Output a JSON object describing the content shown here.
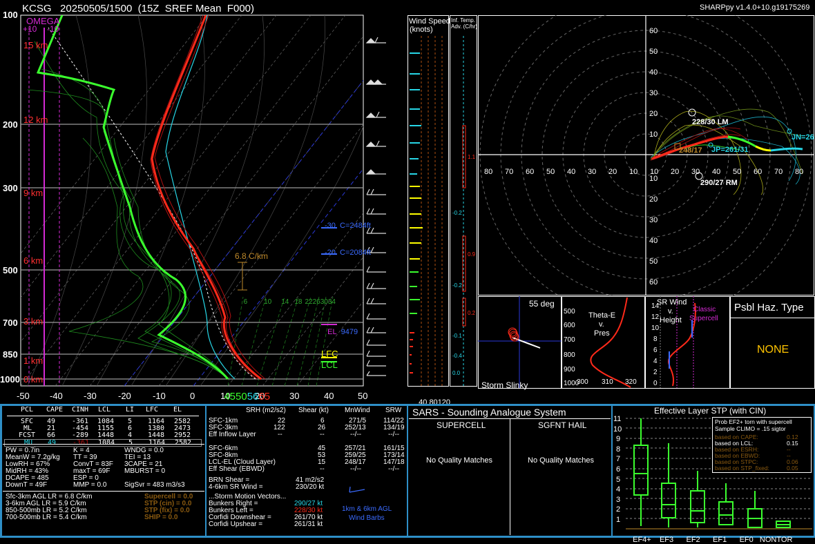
{
  "header": {
    "title": "KCSG   20250505/1500  (15Z  SREF Mean  F000)",
    "version": "SHARPpy v1.4.0+10.g19175269"
  },
  "skewt": {
    "pressure_labels": [
      "100",
      "200",
      "300",
      "500",
      "700",
      "850",
      "1000"
    ],
    "height_labels": [
      "15 km",
      "12 km",
      "9 km",
      "6 km",
      "3 km",
      "1 km",
      "0 km"
    ],
    "temp_labels": [
      "-50",
      "-40",
      "-30",
      "-20",
      "-10",
      "0",
      "10",
      "20",
      "30",
      "40",
      "50"
    ],
    "omega_title": "OMEGA",
    "omega_plus": "+10",
    "omega_minus": "-10",
    "lapse_rate_label": "6.8 C/km",
    "mix_ratio_labels": [
      "6",
      "10",
      "14",
      "18",
      "22",
      "26",
      "30",
      "34"
    ],
    "annotations": {
      "m30": "-30  C=2484ft",
      "m20": "-20  C=2084ft",
      "el": "EL",
      "el_val": "9479",
      "lfc": "LFC",
      "lcl": "LCL"
    },
    "sfc_td": "45",
    "sfc_tw": "50",
    "sfc_wb": "56",
    "sfc_t": "65"
  },
  "wind_speed_panel": {
    "title_line1": "Wind Speed",
    "title_line2": "(knots)",
    "ticks": [
      "40",
      "80",
      "120"
    ]
  },
  "inferred_temp_panel": {
    "title_line1": "Inf. Temp.",
    "title_line2": "Adv. (C/hr)",
    "values": [
      "1.1",
      "-0.2",
      "0.9",
      "-0.2",
      "0.2",
      "-0.1",
      "-0.4",
      "0.0"
    ]
  },
  "hodograph": {
    "rings_y": [
      "60",
      "50",
      "40",
      "30",
      "20",
      "10",
      "10",
      "20",
      "30",
      "40",
      "50",
      "60"
    ],
    "rings_x": [
      "80",
      "70",
      "60",
      "50",
      "40",
      "30",
      "20",
      "10",
      "10",
      "20",
      "30",
      "40",
      "50",
      "60",
      "70",
      "80"
    ],
    "rm_label": "228/30 LM",
    "lm_label": "290/27 RM",
    "mw_label": "248/17",
    "jp_label": "JP=261/31",
    "jn_label": "JN=26"
  },
  "storm_slinky": {
    "angle": "55 deg",
    "title": "Storm Slinky"
  },
  "theta_e": {
    "title_l1": "Theta-E",
    "title_l2": "v.",
    "title_l3": "Pres",
    "p_labels": [
      "500",
      "600",
      "700",
      "800",
      "900",
      "1000"
    ],
    "x_labels": [
      "300",
      "310",
      "320"
    ]
  },
  "sr_wind": {
    "title_l1": "SR Wind",
    "title_l2": "v.",
    "title_l3": "Height",
    "h_labels": [
      "14",
      "12",
      "10",
      "8",
      "6",
      "4",
      "2",
      "0"
    ],
    "classic_l1": "Classic",
    "classic_l2": "Supercell"
  },
  "hazard": {
    "title": "Psbl Haz. Type",
    "value": "NONE"
  },
  "parcels": {
    "headers": [
      "PCL",
      "CAPE",
      "CINH",
      "LCL",
      "LI",
      "LFC",
      "EL"
    ],
    "rows": [
      [
        "SFC",
        "49",
        "-361",
        "1084",
        "5",
        "1164",
        "2582"
      ],
      [
        "ML",
        "21",
        "-454",
        "1155",
        "6",
        "1380",
        "2473"
      ],
      [
        "FCST",
        "66",
        "-289",
        "1448",
        "4",
        "1448",
        "2952"
      ],
      [
        "MU",
        "49",
        "-361",
        "1084",
        "5",
        "1164",
        "2582"
      ]
    ]
  },
  "indices": {
    "col1": [
      "PW = 0.7in",
      "MeanW = 7.2g/kg",
      "LowRH = 67%",
      "MidRH = 43%",
      "DCAPE = 485",
      "DownT = 49F"
    ],
    "col2": [
      "K = 4",
      "TT = 39",
      "ConvT = 83F",
      "maxT = 69F",
      "ESP = 0",
      "MMP = 0.0"
    ],
    "col3": [
      "WNDG = 0.0",
      "TEI = 13",
      "3CAPE = 21",
      "MBURST = 0",
      "",
      "SigSvr = 483 m3/s3"
    ],
    "lapse": [
      "Sfc-3km AGL LR = 6.8 C/km",
      "3-6km AGL LR = 5.9 C/km",
      "850-500mb LR = 5.2 C/km",
      "700-500mb LR = 5.4 C/km"
    ],
    "comp": [
      "Supercell = 0.0",
      "STP (cin) = 0.0",
      "STP (fix) = 0.0",
      "SHIP = 0.0"
    ]
  },
  "kinematics": {
    "headers": [
      "SRH (m2/s2)",
      "Shear (kt)",
      "MnWind",
      "SRW"
    ],
    "rows": [
      [
        "SFC-1km",
        "22",
        "6",
        "271/5",
        "114/22"
      ],
      [
        "SFC-3km",
        "122",
        "26",
        "252/13",
        "134/19"
      ],
      [
        "Eff Inflow Layer",
        "--",
        "--",
        "--/--",
        "--/--"
      ],
      [
        "",
        "",
        "",
        "",
        ""
      ],
      [
        "SFC-6km",
        "",
        "45",
        "257/21",
        "161/15"
      ],
      [
        "SFC-8km",
        "",
        "53",
        "259/25",
        "173/14"
      ],
      [
        "LCL-EL (Cloud Layer)",
        "",
        "15",
        "248/17",
        "147/18"
      ],
      [
        "Eff Shear (EBWD)",
        "",
        "--",
        "--/--",
        "--/--"
      ]
    ],
    "brn_shear": "BRN Shear =",
    "brn_shear_val": "41 m2/s2",
    "sr_wind_4_6": "4-6km SR Wind =",
    "sr_wind_4_6_val": "230/20 kt",
    "storm_motion_title": "...Storm Motion Vectors...",
    "motions": [
      [
        "Bunkers Right =",
        "290/27 kt"
      ],
      [
        "Bunkers Left =",
        "228/30 kt"
      ],
      [
        "Corfidi Downshear =",
        "261/70 kt"
      ],
      [
        "Corfidi Upshear =",
        "261/31 kt"
      ]
    ],
    "barb_caption_l1": "1km & 6km AGL",
    "barb_caption_l2": "Wind Barbs"
  },
  "sars": {
    "title": "SARS - Sounding Analogue System",
    "supercell_title": "SUPERCELL",
    "hail_title": "SGFNT HAIL",
    "supercell_result": "No Quality Matches",
    "hail_result": "No Quality Matches"
  },
  "stp": {
    "title": "Effective Layer STP (with CIN)",
    "y_labels": [
      "11",
      "10",
      "9",
      "8",
      "7",
      "6",
      "5",
      "4",
      "3",
      "2",
      "1",
      "0"
    ],
    "categories": [
      "EF4+",
      "EF3",
      "EF2",
      "EF1",
      "EF0",
      "NONTOR"
    ],
    "legend_title_l1": "Prob EF2+ torn with supercell",
    "legend_title_l2": "Sample CLIMO = .15 sigtor",
    "legend": [
      [
        "based on CAPE:",
        "0.12"
      ],
      [
        "based on LCL:",
        "0.15"
      ],
      [
        "based on ESRH:",
        "--"
      ],
      [
        "based on EBWD:",
        "--"
      ],
      [
        "based on STPC:",
        "0.06"
      ],
      [
        "based on STP_fixed:",
        "0.05"
      ]
    ]
  },
  "colors": {
    "panel_border": "#2e8fc7",
    "temperature": "#ff2a1a",
    "dewpoint": "#3bff2e",
    "wetbulb": "#27d6e6",
    "grid": "#8a8a8a",
    "heights": "#ff3030",
    "omega": "#d42ad4",
    "hazard_text": "#ffc400"
  }
}
